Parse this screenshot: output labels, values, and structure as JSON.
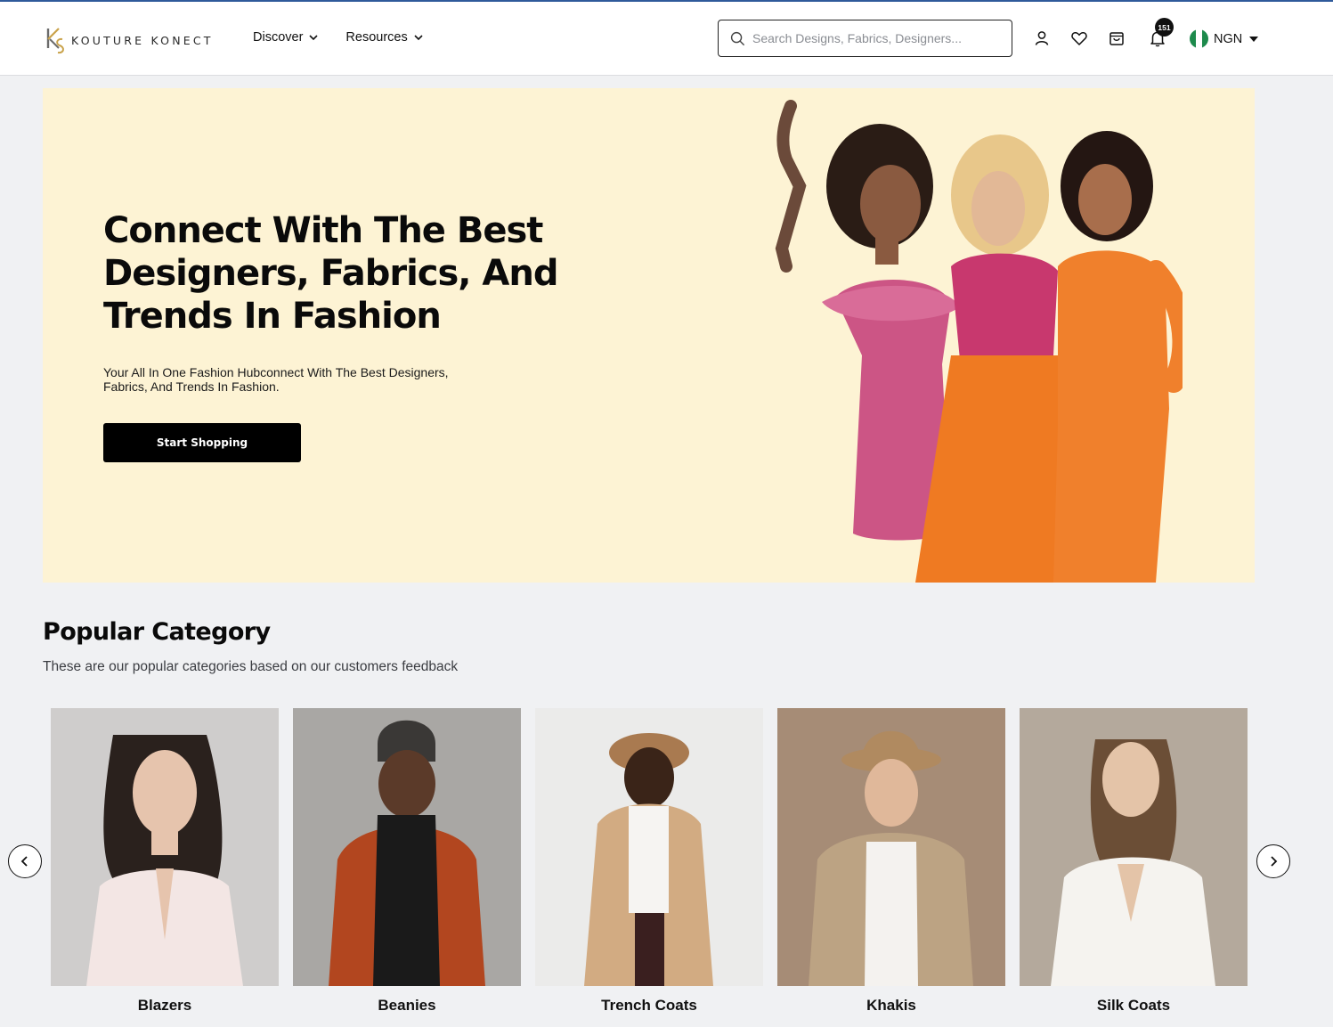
{
  "header": {
    "logo_text": "KOUTURE KONECT",
    "nav": [
      {
        "label": "Discover"
      },
      {
        "label": "Resources"
      }
    ],
    "search_placeholder": "Search Designs, Fabrics, Designers...",
    "notifications_count": "151",
    "currency": "NGN",
    "colors": {
      "accent_line": "#2f5a9a",
      "flag_green": "#1d8a4c"
    }
  },
  "hero": {
    "title": "Connect With The Best Designers, Fabrics, And Trends In Fashion",
    "subtitle": "Your All In One Fashion Hubconnect With The Best Designers, Fabrics, And Trends In Fashion.",
    "cta": "Start Shopping",
    "background": "#fdf3d4"
  },
  "popular": {
    "title": "Popular Category",
    "subtitle": "These are our popular categories based on our customers feedback",
    "categories": [
      {
        "label": "Blazers"
      },
      {
        "label": "Beanies"
      },
      {
        "label": "Trench Coats"
      },
      {
        "label": "Khakis"
      },
      {
        "label": "Silk Coats"
      }
    ]
  },
  "icons": {
    "prev": "chevron-left-icon",
    "next": "chevron-right-icon"
  }
}
